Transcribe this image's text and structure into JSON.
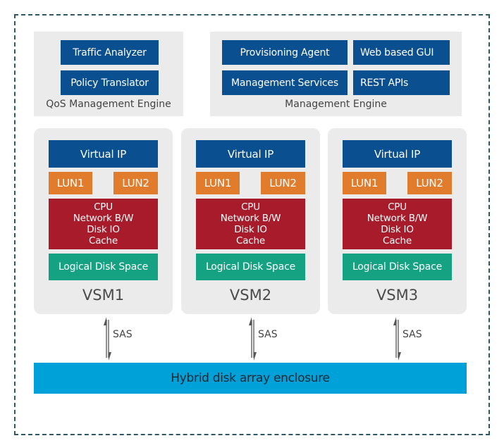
{
  "qos_engine": {
    "label": "QoS Management Engine",
    "components": [
      "Traffic  Analyzer",
      "Policy Translator"
    ]
  },
  "management_engine": {
    "label": "Management Engine",
    "components": [
      "Provisioning Agent",
      "Web based GUI",
      "Management Services",
      "REST APIs"
    ]
  },
  "vsms": [
    {
      "name": "VSM1",
      "virtual_ip": "Virtual IP",
      "luns": [
        "LUN1",
        "LUN2"
      ],
      "resources": [
        "CPU",
        "Network B/W",
        "Disk IO",
        "Cache"
      ],
      "storage": "Logical Disk Space"
    },
    {
      "name": "VSM2",
      "virtual_ip": "Virtual IP",
      "luns": [
        "LUN1",
        "LUN2"
      ],
      "resources": [
        "CPU",
        "Network B/W",
        "Disk IO",
        "Cache"
      ],
      "storage": "Logical Disk Space"
    },
    {
      "name": "VSM3",
      "virtual_ip": "Virtual IP",
      "luns": [
        "LUN1",
        "LUN2"
      ],
      "resources": [
        "CPU",
        "Network B/W",
        "Disk IO",
        "Cache"
      ],
      "storage": "Logical Disk Space"
    }
  ],
  "connections": [
    {
      "from": "VSM1",
      "to": "Hybrid disk array enclosure",
      "label": "SAS"
    },
    {
      "from": "VSM2",
      "to": "Hybrid disk array enclosure",
      "label": "SAS"
    },
    {
      "from": "VSM3",
      "to": "Hybrid disk array enclosure",
      "label": "SAS"
    }
  ],
  "storage_enclosure": {
    "label": "Hybrid disk array enclosure"
  },
  "colors": {
    "component_blue": "#0a4f8f",
    "lun_orange": "#e07c2c",
    "resource_red": "#a81b2a",
    "disk_green": "#14a283",
    "enclosure_cyan": "#00a1d8",
    "panel_gray": "#ebebeb",
    "border_teal": "#2e5866"
  }
}
